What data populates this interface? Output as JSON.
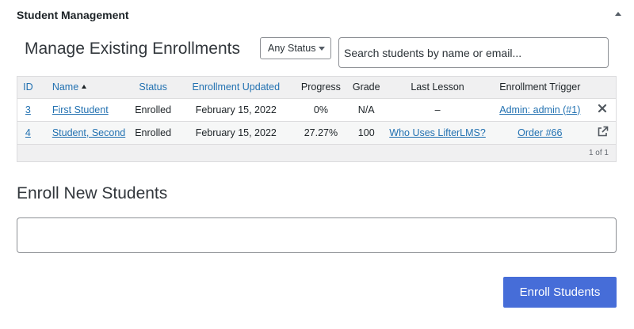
{
  "panel": {
    "title": "Student Management"
  },
  "manage": {
    "title": "Manage Existing Enrollments",
    "status_filter": "Any Status",
    "search_placeholder": "Search students by name or email..."
  },
  "table": {
    "headers": {
      "id": "ID",
      "name": "Name",
      "status": "Status",
      "updated": "Enrollment Updated",
      "progress": "Progress",
      "grade": "Grade",
      "last_lesson": "Last Lesson",
      "trigger": "Enrollment Trigger"
    },
    "rows": [
      {
        "id": "3",
        "name": "First Student",
        "status": "Enrolled",
        "updated": "February 15, 2022",
        "progress": "0%",
        "grade": "N/A",
        "last_lesson": "–",
        "trigger": "Admin: admin (#1)",
        "action_icon": "close-icon"
      },
      {
        "id": "4",
        "name": "Student, Second",
        "status": "Enrolled",
        "updated": "February 15, 2022",
        "progress": "27.27%",
        "grade": "100",
        "last_lesson": "Who Uses LifterLMS?",
        "trigger": "Order #66",
        "action_icon": "external-link-icon"
      }
    ],
    "pagination": "1 of 1"
  },
  "enroll": {
    "title": "Enroll New Students",
    "button_label": "Enroll Students"
  },
  "colors": {
    "link": "#2271b1",
    "button": "#466dd8",
    "header_bg": "#f0f0f1"
  }
}
